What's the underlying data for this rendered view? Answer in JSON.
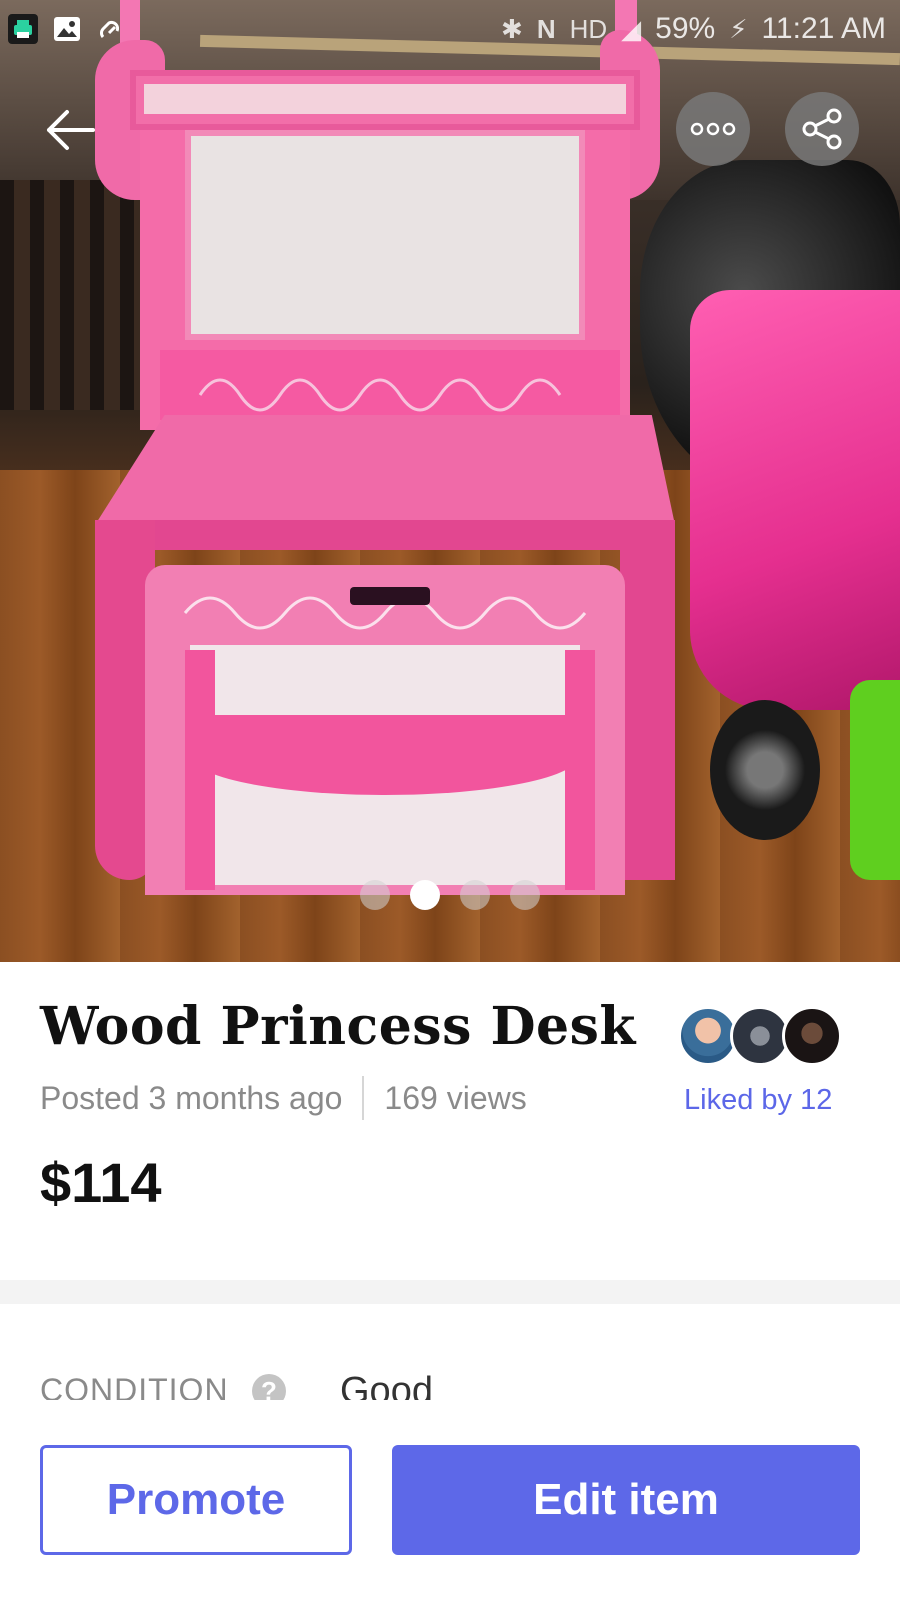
{
  "status_bar": {
    "battery": "59%",
    "time": "11:21 AM",
    "network": "HD",
    "left_icons": [
      "fax-icon",
      "image-icon",
      "link-icon"
    ],
    "right_icons": [
      "bluetooth-icon",
      "nfc-icon",
      "signal-icon",
      "charging-icon"
    ]
  },
  "nav": {
    "back_icon": "arrow-left-icon",
    "more_icon": "more-dots-icon",
    "share_icon": "share-icon"
  },
  "gallery": {
    "page_count": 4,
    "active_index": 1
  },
  "listing": {
    "title": "Wood Princess Desk",
    "posted": "Posted 3 months ago",
    "views": "169 views",
    "price": "$114",
    "liked_by": "Liked by 12"
  },
  "details": {
    "condition_label": "CONDITION",
    "condition_value": "Good"
  },
  "actions": {
    "promote_label": "Promote",
    "edit_label": "Edit item"
  },
  "colors": {
    "accent": "#5d68e8",
    "muted_text": "#8a8a8a"
  }
}
